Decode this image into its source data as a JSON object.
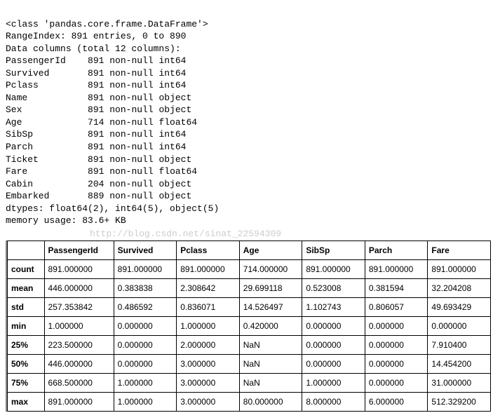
{
  "info": {
    "class_line": "<class 'pandas.core.frame.DataFrame'>",
    "range_index": "RangeIndex: 891 entries, 0 to 890",
    "data_columns": "Data columns (total 12 columns):",
    "columns": [
      {
        "name": "PassengerId",
        "detail": "891 non-null int64"
      },
      {
        "name": "Survived",
        "detail": "891 non-null int64"
      },
      {
        "name": "Pclass",
        "detail": "891 non-null int64"
      },
      {
        "name": "Name",
        "detail": "891 non-null object"
      },
      {
        "name": "Sex",
        "detail": "891 non-null object"
      },
      {
        "name": "Age",
        "detail": "714 non-null float64"
      },
      {
        "name": "SibSp",
        "detail": "891 non-null int64"
      },
      {
        "name": "Parch",
        "detail": "891 non-null int64"
      },
      {
        "name": "Ticket",
        "detail": "891 non-null object"
      },
      {
        "name": "Fare",
        "detail": "891 non-null float64"
      },
      {
        "name": "Cabin",
        "detail": "204 non-null object"
      },
      {
        "name": "Embarked",
        "detail": "889 non-null object"
      }
    ],
    "dtypes": "dtypes: float64(2), int64(5), object(5)",
    "memory": "memory usage: 83.6+ KB"
  },
  "watermark": "http://blog.csdn.net/sinat_22594309",
  "describe": {
    "headers": [
      "",
      "PassengerId",
      "Survived",
      "Pclass",
      "Age",
      "SibSp",
      "Parch",
      "Fare"
    ],
    "rows": [
      {
        "label": "count",
        "values": [
          "891.000000",
          "891.000000",
          "891.000000",
          "714.000000",
          "891.000000",
          "891.000000",
          "891.000000"
        ]
      },
      {
        "label": "mean",
        "values": [
          "446.000000",
          "0.383838",
          "2.308642",
          "29.699118",
          "0.523008",
          "0.381594",
          "32.204208"
        ]
      },
      {
        "label": "std",
        "values": [
          "257.353842",
          "0.486592",
          "0.836071",
          "14.526497",
          "1.102743",
          "0.806057",
          "49.693429"
        ]
      },
      {
        "label": "min",
        "values": [
          "1.000000",
          "0.000000",
          "1.000000",
          "0.420000",
          "0.000000",
          "0.000000",
          "0.000000"
        ]
      },
      {
        "label": "25%",
        "values": [
          "223.500000",
          "0.000000",
          "2.000000",
          "NaN",
          "0.000000",
          "0.000000",
          "7.910400"
        ]
      },
      {
        "label": "50%",
        "values": [
          "446.000000",
          "0.000000",
          "3.000000",
          "NaN",
          "0.000000",
          "0.000000",
          "14.454200"
        ]
      },
      {
        "label": "75%",
        "values": [
          "668.500000",
          "1.000000",
          "3.000000",
          "NaN",
          "1.000000",
          "0.000000",
          "31.000000"
        ]
      },
      {
        "label": "max",
        "values": [
          "891.000000",
          "1.000000",
          "3.000000",
          "80.000000",
          "8.000000",
          "6.000000",
          "512.329200"
        ]
      }
    ]
  }
}
